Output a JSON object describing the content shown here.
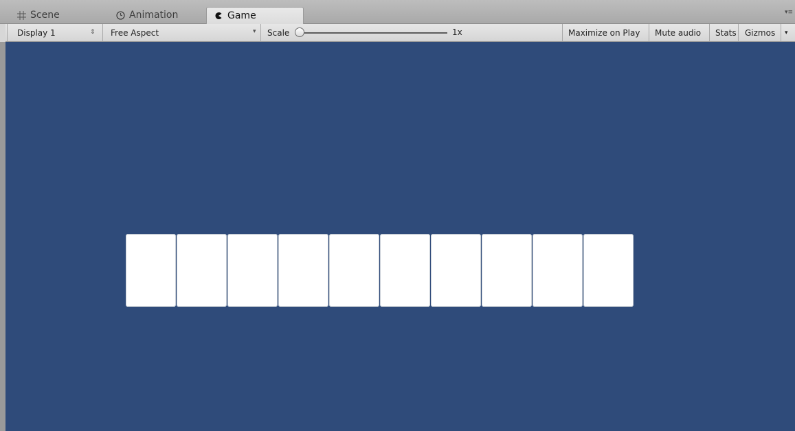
{
  "tabs": [
    {
      "label": "Scene",
      "icon": "grid-icon",
      "active": false
    },
    {
      "label": "Animation",
      "icon": "clock-icon",
      "active": false
    },
    {
      "label": "Game",
      "icon": "pacman-icon",
      "active": true
    }
  ],
  "toolbar": {
    "display": "Display 1",
    "aspect": "Free Aspect",
    "scale_label": "Scale",
    "scale_value": "1x",
    "scale_slider_fraction": 0.0,
    "maximize_on_play": "Maximize on Play",
    "mute_audio": "Mute audio",
    "stats": "Stats",
    "gizmos": "Gizmos"
  },
  "game_view": {
    "background_color": "#2f4b7a",
    "card_color": "#ffffff",
    "card_count": 10
  }
}
